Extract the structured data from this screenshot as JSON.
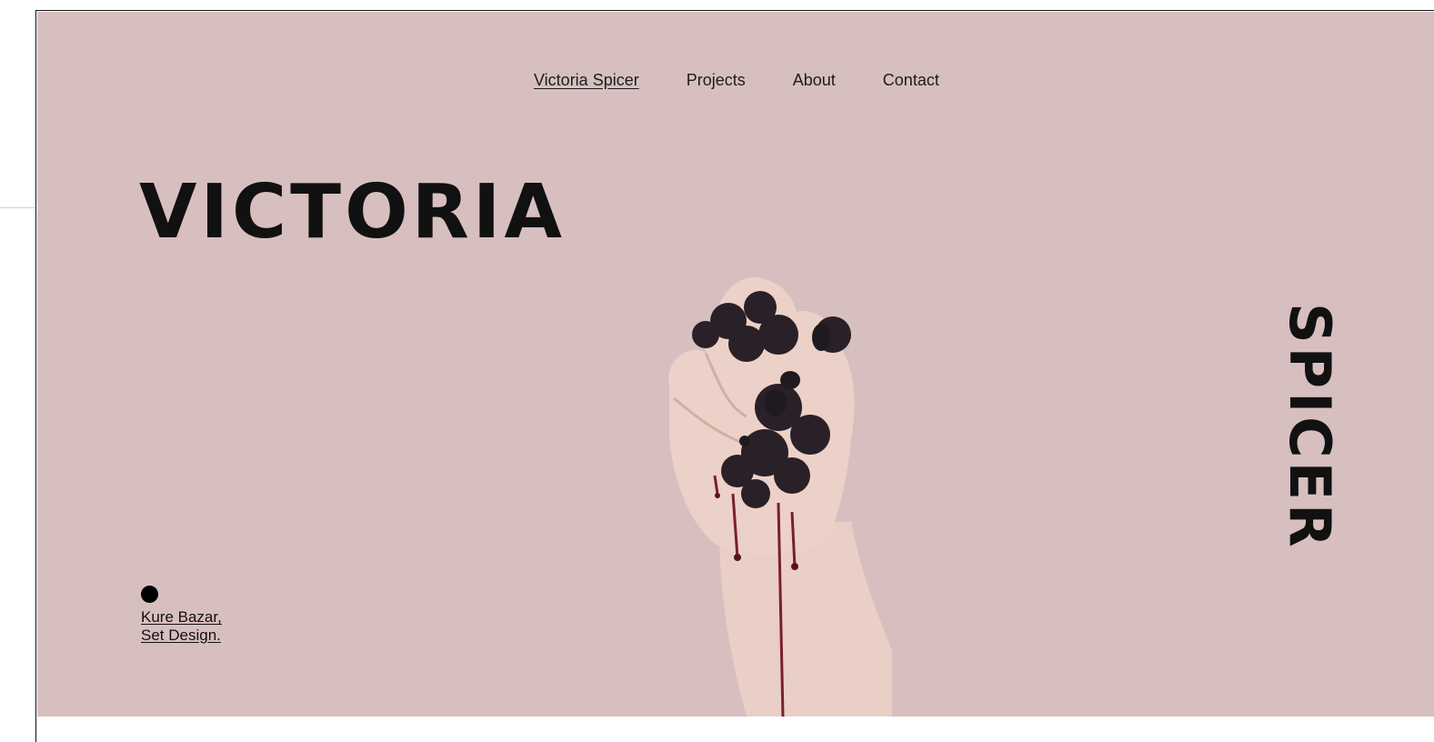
{
  "nav": {
    "home_label": "Victoria Spicer",
    "items": [
      "Projects",
      "About",
      "Contact"
    ]
  },
  "hero": {
    "first_name": "VICTORIA",
    "last_name": "SPICER",
    "featured_project": {
      "line1": "Kure Bazar,",
      "line2": "Set Design."
    },
    "image_subject": "hand-crushing-blackberries-image"
  },
  "colors": {
    "hero_background": "#d8bfbf",
    "text": "#111111"
  }
}
